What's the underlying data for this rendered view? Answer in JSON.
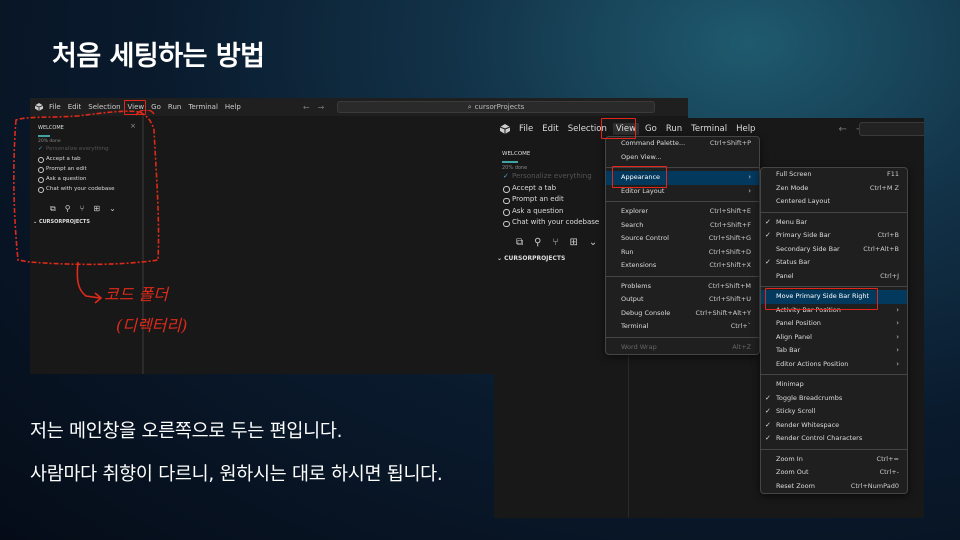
{
  "slide": {
    "title": "처음 세팅하는 방법",
    "caption1": "저는 메인창을 오른쪽으로 두는 편입니다.",
    "caption2": "사람마다 취향이 다르니, 원하시는 대로 하시면 됩니다."
  },
  "annotation": {
    "line1": "코드 폴더",
    "line2": "(디렉터리)",
    "color": "#e02a1a"
  },
  "menubar": {
    "items": [
      "File",
      "Edit",
      "Selection",
      "View",
      "Go",
      "Run",
      "Terminal",
      "Help"
    ],
    "search_text": "cursorProjects"
  },
  "sidebar": {
    "header": "WELCOME",
    "progress_text": "20% done",
    "steps": [
      {
        "label": "Personalize everything",
        "done": true
      },
      {
        "label": "Accept a tab",
        "done": false
      },
      {
        "label": "Prompt an edit",
        "done": false
      },
      {
        "label": "Ask a question",
        "done": false
      },
      {
        "label": "Chat with your codebase",
        "done": false
      }
    ],
    "icons": [
      "files-icon",
      "search-icon",
      "source-control-icon",
      "extensions-icon",
      "chevron-down-icon"
    ],
    "folder_label": "CURSORPROJECTS"
  },
  "view_menu": {
    "items": [
      {
        "label": "Command Palette...",
        "shortcut": "Ctrl+Shift+P"
      },
      {
        "label": "Open View...",
        "shortcut": ""
      },
      {
        "sep": true
      },
      {
        "label": "Appearance",
        "submenu": true,
        "highlight": true
      },
      {
        "label": "Editor Layout",
        "submenu": true
      },
      {
        "sep": true
      },
      {
        "label": "Explorer",
        "shortcut": "Ctrl+Shift+E"
      },
      {
        "label": "Search",
        "shortcut": "Ctrl+Shift+F"
      },
      {
        "label": "Source Control",
        "shortcut": "Ctrl+Shift+G"
      },
      {
        "label": "Run",
        "shortcut": "Ctrl+Shift+D"
      },
      {
        "label": "Extensions",
        "shortcut": "Ctrl+Shift+X"
      },
      {
        "sep": true
      },
      {
        "label": "Problems",
        "shortcut": "Ctrl+Shift+M"
      },
      {
        "label": "Output",
        "shortcut": "Ctrl+Shift+U"
      },
      {
        "label": "Debug Console",
        "shortcut": "Ctrl+Shift+Alt+Y"
      },
      {
        "label": "Terminal",
        "shortcut": "Ctrl+`"
      },
      {
        "sep": true
      },
      {
        "label": "Word Wrap",
        "shortcut": "Alt+Z",
        "disabled": true
      }
    ]
  },
  "appearance_menu": {
    "items": [
      {
        "label": "Full Screen",
        "shortcut": "F11"
      },
      {
        "label": "Zen Mode",
        "shortcut": "Ctrl+M Z"
      },
      {
        "label": "Centered Layout",
        "shortcut": ""
      },
      {
        "sep": true
      },
      {
        "label": "Menu Bar",
        "checked": true
      },
      {
        "label": "Primary Side Bar",
        "shortcut": "Ctrl+B",
        "checked": true
      },
      {
        "label": "Secondary Side Bar",
        "shortcut": "Ctrl+Alt+B"
      },
      {
        "label": "Status Bar",
        "checked": true
      },
      {
        "label": "Panel",
        "shortcut": "Ctrl+J"
      },
      {
        "sep": true
      },
      {
        "label": "Move Primary Side Bar Right",
        "highlight": true
      },
      {
        "label": "Activity Bar Position",
        "submenu": true
      },
      {
        "label": "Panel Position",
        "submenu": true
      },
      {
        "label": "Align Panel",
        "submenu": true
      },
      {
        "label": "Tab Bar",
        "submenu": true
      },
      {
        "label": "Editor Actions Position",
        "submenu": true
      },
      {
        "sep": true
      },
      {
        "label": "Minimap"
      },
      {
        "label": "Toggle Breadcrumbs",
        "checked": true
      },
      {
        "label": "Sticky Scroll",
        "checked": true
      },
      {
        "label": "Render Whitespace",
        "checked": true
      },
      {
        "label": "Render Control Characters",
        "checked": true
      },
      {
        "sep": true
      },
      {
        "label": "Zoom In",
        "shortcut": "Ctrl+="
      },
      {
        "label": "Zoom Out",
        "shortcut": "Ctrl+-"
      },
      {
        "label": "Reset Zoom",
        "shortcut": "Ctrl+NumPad0"
      }
    ]
  },
  "colors": {
    "highlight": "#04395e",
    "red_outline": "#e3261b",
    "accent_teal": "#3fa3a3"
  }
}
